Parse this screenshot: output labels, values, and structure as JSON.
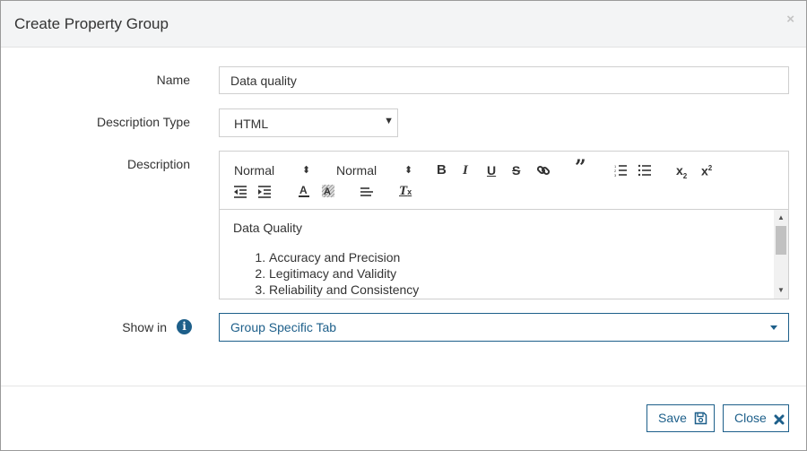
{
  "dialog": {
    "title": "Create Property Group",
    "close_glyph": "×"
  },
  "form": {
    "name_label": "Name",
    "name_value": "Data quality",
    "description_type_label": "Description Type",
    "description_type_value": "HTML",
    "description_label": "Description",
    "show_in_label": "Show in",
    "show_in_value": "Group Specific Tab"
  },
  "editor": {
    "toolbar": {
      "header_select": "Normal",
      "size_select": "Normal",
      "bold": "B",
      "italic": "I",
      "underline": "U",
      "strike": "S",
      "blockquote": "”",
      "subscript": "x",
      "subscript_sub": "2",
      "superscript": "x",
      "superscript_sup": "2",
      "clear_format": "T"
    },
    "content": {
      "heading": "Data Quality",
      "items": [
        "Accuracy and Precision",
        "Legitimacy and Validity",
        "Reliability and Consistency"
      ]
    }
  },
  "footer": {
    "save_label": "Save",
    "close_label": "Close"
  },
  "colors": {
    "accent": "#1d5f8a",
    "header_bg": "#f3f4f5",
    "border": "#cfcfcf"
  }
}
